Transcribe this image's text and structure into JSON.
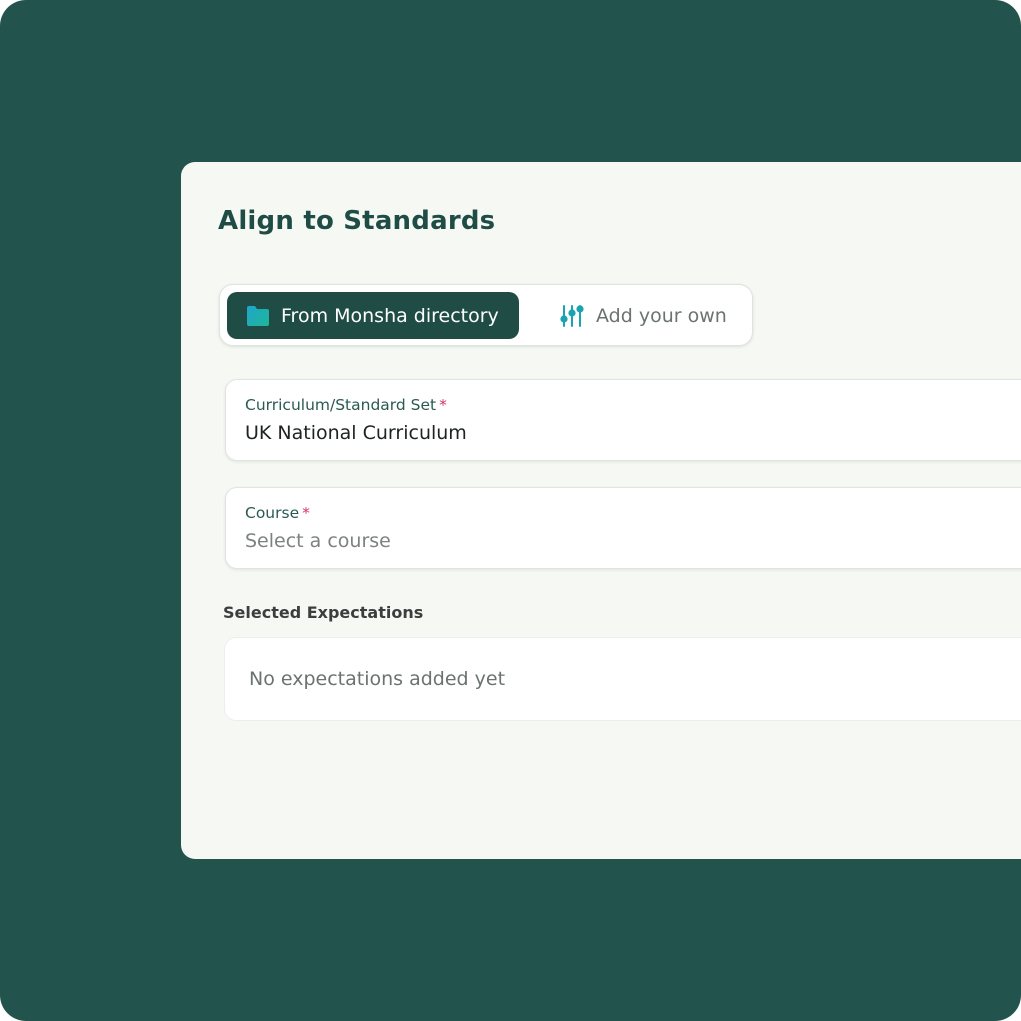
{
  "colors": {
    "background": "#22544d",
    "panel": "#f6f9f3",
    "primary": "#1f4d46",
    "required": "#d6336c",
    "icon_accent": "#1aa3b0"
  },
  "dialog": {
    "title": "Align to Standards"
  },
  "source_toggle": {
    "options": [
      {
        "label": "From Monsha directory",
        "icon": "folder-icon",
        "selected": true
      },
      {
        "label": "Add your own",
        "icon": "sliders-icon",
        "selected": false
      }
    ]
  },
  "fields": {
    "curriculum": {
      "label": "Curriculum/Standard Set",
      "required_mark": "*",
      "value": "UK National Curriculum"
    },
    "course": {
      "label": "Course",
      "required_mark": "*",
      "placeholder": "Select a course"
    }
  },
  "expectations": {
    "label": "Selected Expectations",
    "empty_text": "No expectations added yet"
  }
}
